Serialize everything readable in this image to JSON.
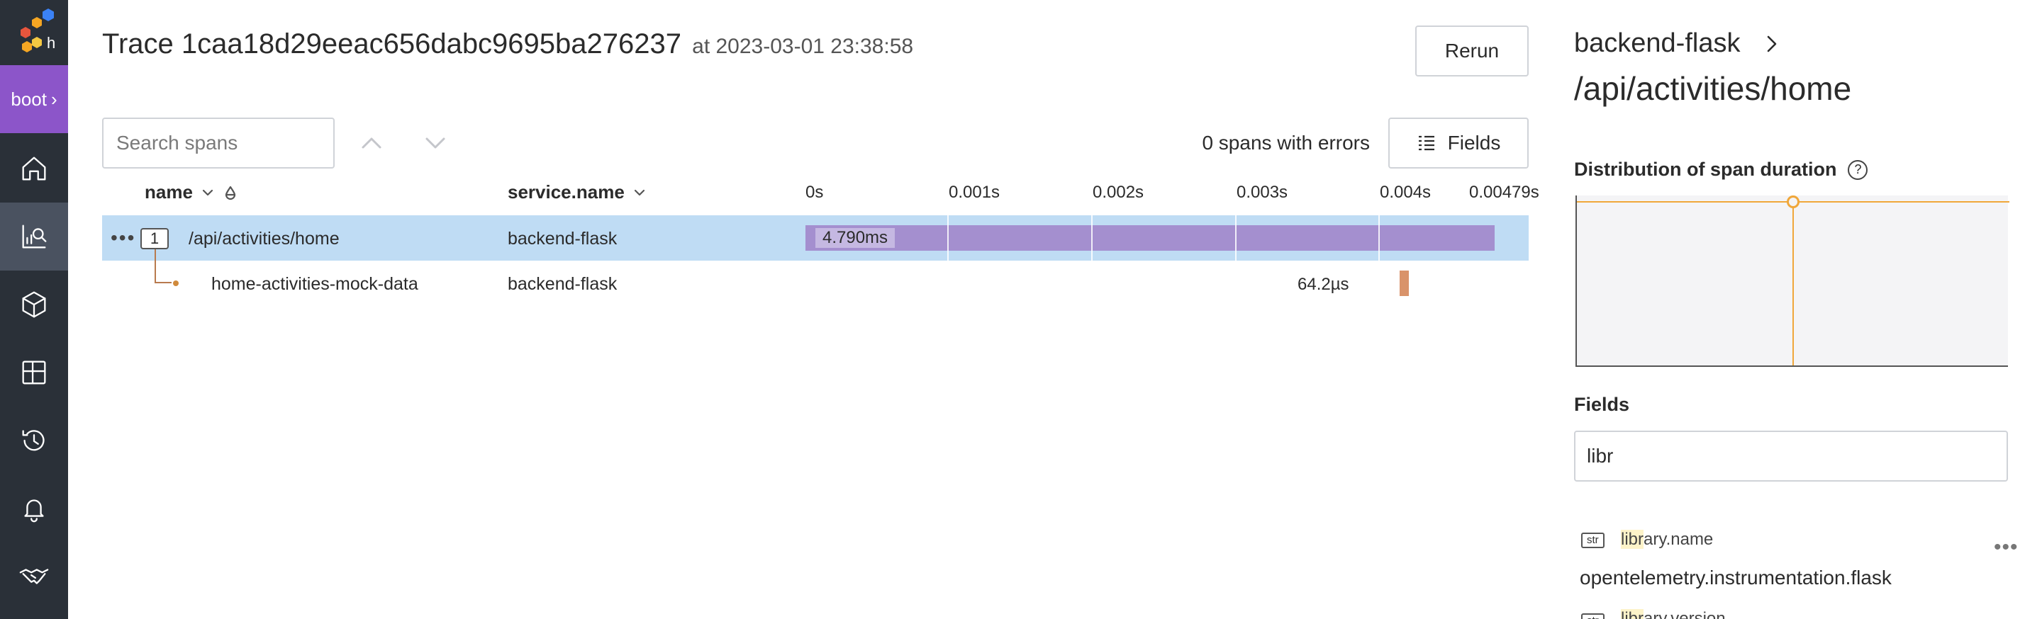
{
  "nav": {
    "environment": "boot",
    "items": [
      "home",
      "query",
      "datasets",
      "boards",
      "history",
      "triggers",
      "team"
    ]
  },
  "header": {
    "title": "Trace 1caa18d29eeac656dabc9695ba276237",
    "timestamp": "at 2023-03-01 23:38:58",
    "rerun_label": "Rerun"
  },
  "toolbar": {
    "search_placeholder": "Search spans",
    "errors_text": "0 spans with errors",
    "fields_label": "Fields"
  },
  "columns": {
    "name": "name",
    "service": "service.name",
    "ticks": [
      "0s",
      "0.001s",
      "0.002s",
      "0.003s",
      "0.004s",
      "0.00479s"
    ]
  },
  "spans": [
    {
      "count": "1",
      "name": "/api/activities/home",
      "service": "backend-flask",
      "duration": "4.790ms",
      "start_s": 0,
      "duration_s": 0.00479
    },
    {
      "name": "home-activities-mock-data",
      "service": "backend-flask",
      "duration": "64.2µs",
      "start_s": 0.00413,
      "duration_s": 6.42e-05
    }
  ],
  "panel": {
    "service": "backend-flask",
    "span_name": "/api/activities/home",
    "distribution_title": "Distribution of span duration",
    "fields_title": "Fields",
    "filter_value": "libr",
    "fields": [
      {
        "type": "str",
        "match": "libr",
        "rest": "ary.name",
        "value": "opentelemetry.instrumentation.flask"
      },
      {
        "type": "str",
        "match": "libr",
        "rest": "ary.version"
      }
    ]
  },
  "colors": {
    "nav_bg": "#2a3038",
    "env_bg": "#8c55c9",
    "selected_row": "#bfdcf4",
    "root_bar": "#a48fcf",
    "child_bar": "#d9936a",
    "heatmap_line": "#f0a73a"
  }
}
